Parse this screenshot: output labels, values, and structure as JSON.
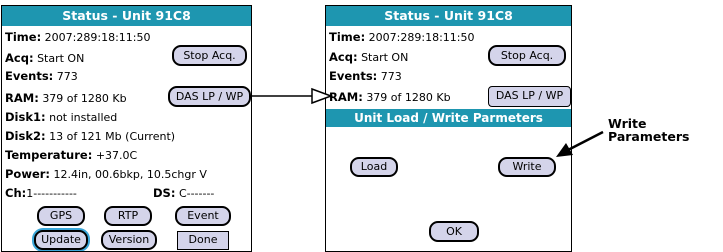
{
  "left": {
    "title": "Status - Unit 91C8",
    "time": {
      "label": "Time:",
      "value": "2007:289:18:11:50"
    },
    "acq": {
      "label": "Acq:",
      "value": "Start ON"
    },
    "stop_acq": "Stop Acq.",
    "events": {
      "label": "Events:",
      "value": "773"
    },
    "ram": {
      "label": "RAM:",
      "value": "379 of 1280 Kb"
    },
    "das_lp_wp": "DAS LP / WP",
    "disk1": {
      "label": "Disk1:",
      "value": "not installed"
    },
    "disk2": {
      "label": "Disk2:",
      "value": "13 of 121 Mb (Current)"
    },
    "temperature": {
      "label": "Temperature:",
      "value": "+37.0C"
    },
    "power": {
      "label": "Power:",
      "value": "12.4in, 00.6bkp, 10.5chgr V"
    },
    "ch": {
      "label": "Ch:",
      "value": "1-----------"
    },
    "ds": {
      "label": "DS:",
      "value": "C-------"
    },
    "buttons": {
      "gps": "GPS",
      "rtp": "RTP",
      "event": "Event",
      "update": "Update",
      "version": "Version",
      "done": "Done"
    }
  },
  "right": {
    "title": "Status - Unit 91C8",
    "time": {
      "label": "Time:",
      "value": "2007:289:18:11:50"
    },
    "acq": {
      "label": "Acq:",
      "value": "Start ON"
    },
    "stop_acq": "Stop Acq.",
    "events": {
      "label": "Events:",
      "value": "773"
    },
    "ram": {
      "label": "RAM:",
      "value": "379 of 1280 Kb"
    },
    "das_lp_wp": "DAS LP / WP",
    "dialog_title": "Unit Load / Write Parmeters",
    "load": "Load",
    "write": "Write",
    "ok": "OK"
  },
  "callout": {
    "line1": "Write",
    "line2": "Parameters"
  },
  "colors": {
    "title_bar": "#1e96b0",
    "button_fill": "#d4d4ea",
    "selected_ring": "#3aa6d8"
  }
}
